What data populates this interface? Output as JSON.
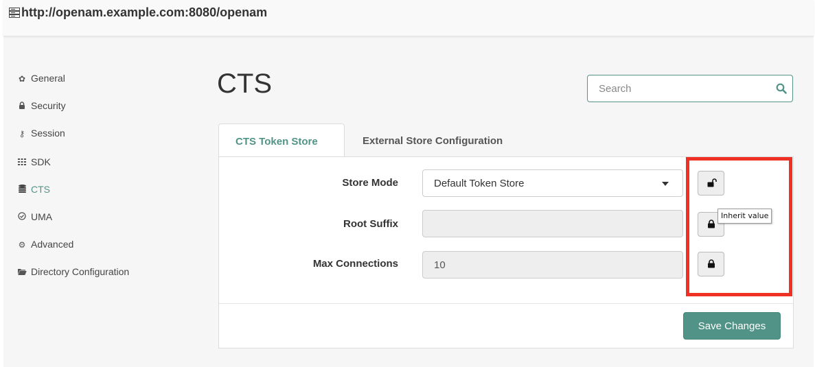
{
  "address_bar": {
    "url": "http://openam.example.com:8080/openam",
    "icon": "server-icon"
  },
  "sidebar": {
    "items": [
      {
        "label": "General",
        "icon": "gear-icon"
      },
      {
        "label": "Security",
        "icon": "lock-icon"
      },
      {
        "label": "Session",
        "icon": "key-icon"
      },
      {
        "label": "SDK",
        "icon": "grid-icon"
      },
      {
        "label": "CTS",
        "icon": "database-icon",
        "active": true
      },
      {
        "label": "UMA",
        "icon": "check-circle-icon"
      },
      {
        "label": "Advanced",
        "icon": "cogs-icon"
      },
      {
        "label": "Directory Configuration",
        "icon": "folder-open-icon"
      }
    ]
  },
  "page": {
    "title": "CTS"
  },
  "search": {
    "placeholder": "Search",
    "icon": "search-icon"
  },
  "tabs": [
    {
      "label": "CTS Token Store",
      "active": true
    },
    {
      "label": "External Store Configuration",
      "active": false
    }
  ],
  "form": {
    "store_mode": {
      "label": "Store Mode",
      "value": "Default Token Store",
      "lock": "unlocked"
    },
    "root_suffix": {
      "label": "Root Suffix",
      "value": "",
      "lock": "locked"
    },
    "max_connections": {
      "label": "Max Connections",
      "value": "10",
      "lock": "locked"
    }
  },
  "tooltip": {
    "text": "Inherit value"
  },
  "actions": {
    "save_label": "Save Changes"
  },
  "colors": {
    "accent": "#519387",
    "highlight": "#ee3124"
  }
}
